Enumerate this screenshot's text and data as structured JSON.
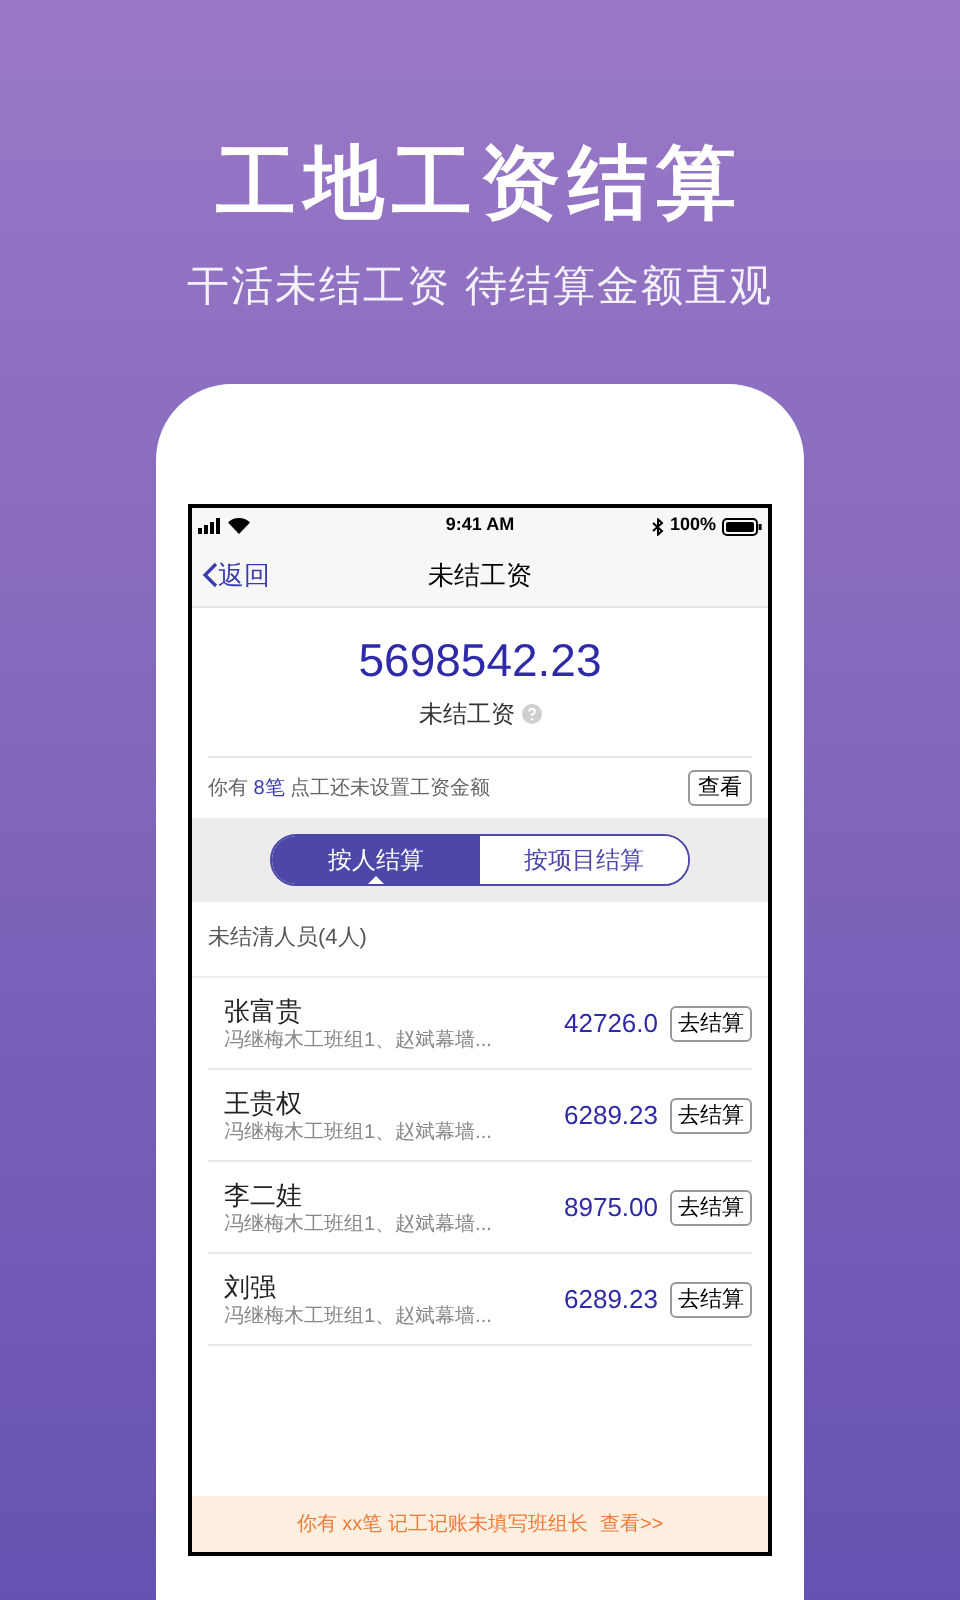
{
  "headline": "工地工资结算",
  "subheadline": "干活未结工资 待结算金额直观",
  "status_bar": {
    "time": "9:41 AM",
    "battery": "100%"
  },
  "nav": {
    "back": "返回",
    "title": "未结工资"
  },
  "summary": {
    "amount": "5698542.23",
    "label": "未结工资"
  },
  "notice": {
    "prefix": "你有",
    "count": "8笔",
    "suffix": "点工还未设置工资金额",
    "button": "查看"
  },
  "tabs": [
    {
      "label": "按人结算",
      "selected": true
    },
    {
      "label": "按项目结算",
      "selected": false
    }
  ],
  "section_title": "未结清人员(4人)",
  "people": [
    {
      "name": "张富贵",
      "groups": "冯继梅木工班组1、赵斌幕墙...",
      "amount": "42726.0",
      "button": "去结算"
    },
    {
      "name": "王贵权",
      "groups": "冯继梅木工班组1、赵斌幕墙...",
      "amount": "6289.23",
      "button": "去结算"
    },
    {
      "name": "李二娃",
      "groups": "冯继梅木工班组1、赵斌幕墙...",
      "amount": "8975.00",
      "button": "去结算"
    },
    {
      "name": "刘强",
      "groups": "冯继梅木工班组1、赵斌幕墙...",
      "amount": "6289.23",
      "button": "去结算"
    }
  ],
  "footer_banner": {
    "text": "你有 xx笔 记工记账未填写班组长",
    "link": "查看>>"
  }
}
